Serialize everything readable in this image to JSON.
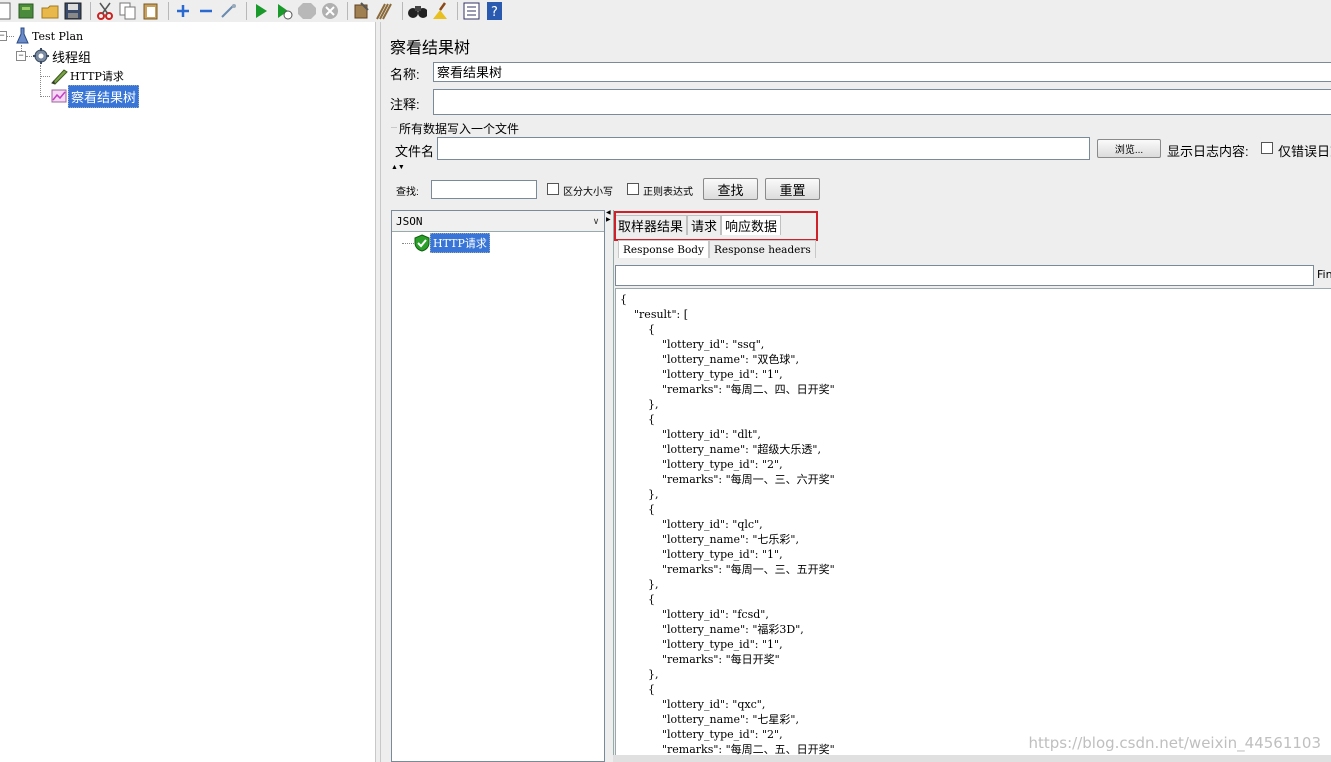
{
  "toolbar": {
    "icons": [
      "new-icon",
      "templates-icon",
      "open-icon",
      "save-icon",
      "cut-icon",
      "copy-icon",
      "paste-icon",
      "expand-icon",
      "collapse-icon",
      "toggle-icon",
      "start-icon",
      "start-no-pause-icon",
      "stop-icon",
      "shutdown-icon",
      "clear-icon",
      "clear-all-icon",
      "search-icon",
      "reset-search-icon",
      "function-helper-icon",
      "help-icon"
    ]
  },
  "tree": {
    "items": [
      {
        "label": "Test Plan"
      },
      {
        "label": "线程组"
      },
      {
        "label": "HTTP请求"
      },
      {
        "label": "察看结果树"
      }
    ]
  },
  "panel": {
    "title": "察看结果树",
    "name_label": "名称:",
    "name_value": "察看结果树",
    "comment_label": "注释:",
    "comment_value": "",
    "file_group_title": "所有数据写入一个文件",
    "filename_label": "文件名",
    "filename_value": "",
    "browse_button": "浏览...",
    "log_label": "显示日志内容:",
    "errors_only_label": "仅错误日志"
  },
  "search": {
    "label": "查找:",
    "value": "",
    "case_label": "区分大小写",
    "regex_label": "正则表达式",
    "find_button": "查找",
    "reset_button": "重置"
  },
  "results": {
    "renderer": "JSON",
    "samples": [
      {
        "label": "HTTP请求",
        "status": "success"
      }
    ],
    "tabs": [
      {
        "label": "取样器结果",
        "active": false
      },
      {
        "label": "请求",
        "active": false
      },
      {
        "label": "响应数据",
        "active": true
      }
    ],
    "subtabs": [
      {
        "label": "Response Body",
        "active": true
      },
      {
        "label": "Response headers",
        "active": false
      }
    ],
    "find_label": "Fin",
    "body_lines": [
      "{",
      "    \"result\": [",
      "        {",
      "            \"lottery_id\": \"ssq\",",
      "            \"lottery_name\": \"双色球\",",
      "            \"lottery_type_id\": \"1\",",
      "            \"remarks\": \"每周二、四、日开奖\"",
      "        },",
      "        {",
      "            \"lottery_id\": \"dlt\",",
      "            \"lottery_name\": \"超级大乐透\",",
      "            \"lottery_type_id\": \"2\",",
      "            \"remarks\": \"每周一、三、六开奖\"",
      "        },",
      "        {",
      "            \"lottery_id\": \"qlc\",",
      "            \"lottery_name\": \"七乐彩\",",
      "            \"lottery_type_id\": \"1\",",
      "            \"remarks\": \"每周一、三、五开奖\"",
      "        },",
      "        {",
      "            \"lottery_id\": \"fcsd\",",
      "            \"lottery_name\": \"福彩3D\",",
      "            \"lottery_type_id\": \"1\",",
      "            \"remarks\": \"每日开奖\"",
      "        },",
      "        {",
      "            \"lottery_id\": \"qxc\",",
      "            \"lottery_name\": \"七星彩\",",
      "            \"lottery_type_id\": \"2\",",
      "            \"remarks\": \"每周二、五、日开奖\""
    ]
  },
  "watermark": "https://blog.csdn.net/weixin_44561103",
  "colors": {
    "selection": "#3875d7",
    "highlight_box": "#d0202a",
    "panel_bg": "#eeeeee"
  }
}
